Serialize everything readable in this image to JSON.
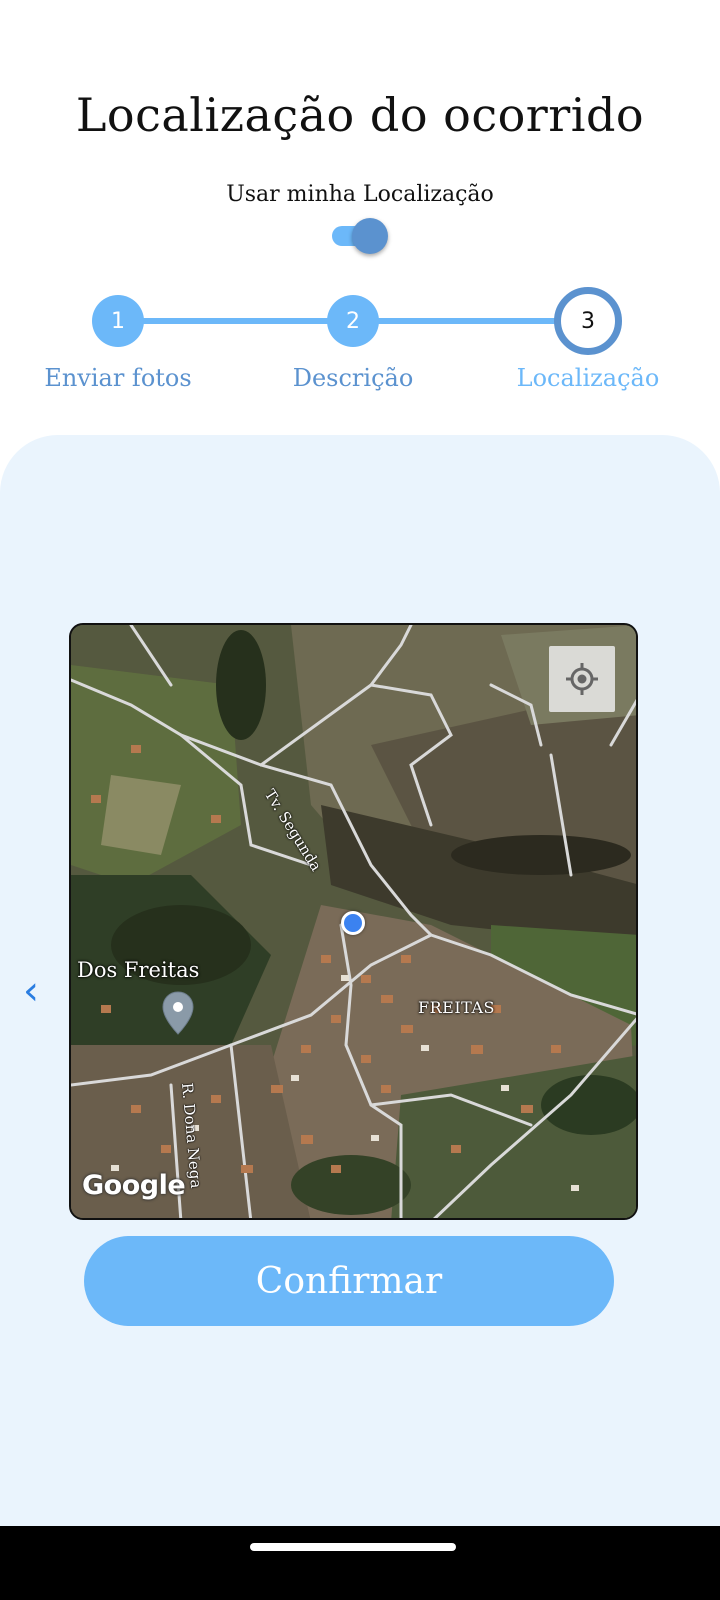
{
  "header": {
    "title": "Localização do ocorrido",
    "toggle_label": "Usar minha Localização",
    "toggle_on": true
  },
  "stepper": {
    "steps": [
      {
        "number": "1",
        "label": "Enviar fotos",
        "state": "done"
      },
      {
        "number": "2",
        "label": "Descrição",
        "state": "done"
      },
      {
        "number": "3",
        "label": "Localização",
        "state": "active"
      }
    ]
  },
  "map": {
    "place_label": "Dos Freitas",
    "area_label": "FREITAS",
    "streets": [
      "Tv. Segunda",
      "R. Dona Nega"
    ],
    "attribution": "Google",
    "my_location_icon": "crosshair-icon",
    "user_marker_icon": "user-location-dot",
    "place_marker_icon": "place-pin-icon"
  },
  "actions": {
    "back_icon": "chevron-left-icon",
    "confirm_label": "Confirmar"
  },
  "colors": {
    "accent": "#6cb8f9",
    "accent_dark": "#5b92cf",
    "panel_bg": "#eaf4fd",
    "back_chevron": "#2a7de1"
  }
}
